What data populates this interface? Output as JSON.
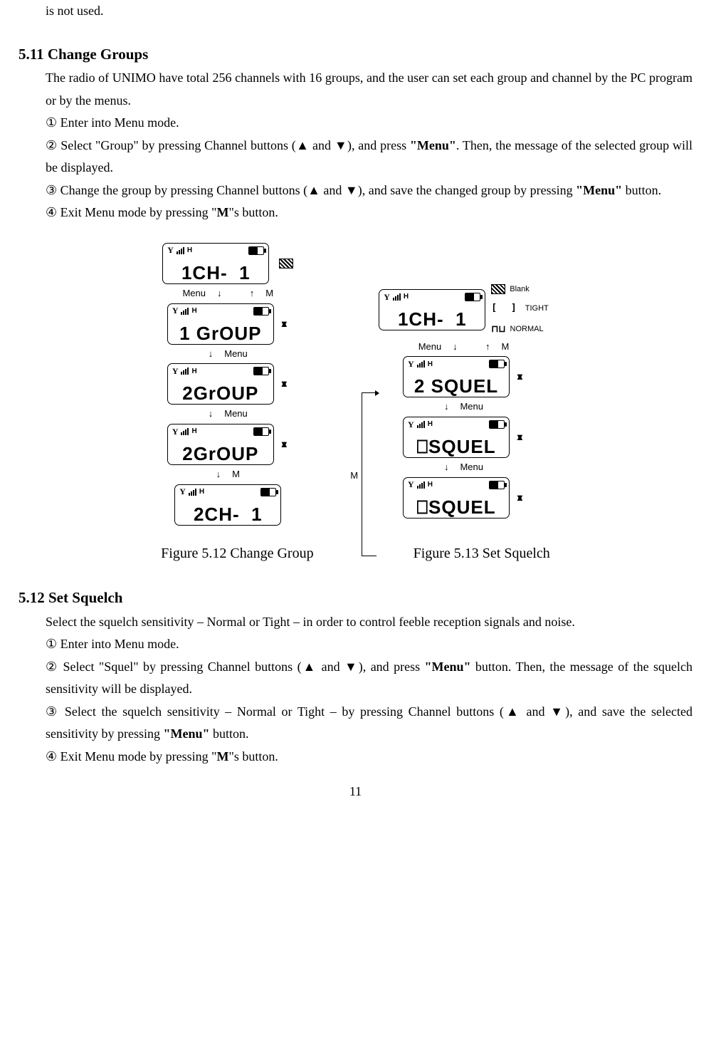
{
  "topFragment": "is not used.",
  "section511": {
    "heading": "5.11 Change Groups",
    "intro": "The radio of UNIMO have total 256 channels with 16 groups, and the user can set each group and channel by the PC program or by the menus.",
    "step1": "① Enter into Menu mode.",
    "step2a": "② Select \"Group\" by pressing Channel buttons (▲ and ▼), and press ",
    "step2b": "\"Menu\"",
    "step2c": ". Then, the message of the selected group will be displayed.",
    "step3a": "③ Change the group by pressing Channel buttons (▲ and ▼), and save the changed group by pressing ",
    "step3b": "\"Menu\"",
    "step3c": " button.",
    "step4a": "④ Exit Menu mode by pressing \"",
    "step4b": "M",
    "step4c": "\"s button."
  },
  "figureLeft": {
    "s1": "1CH-  1",
    "s2": "1 GrOUP",
    "s3": "2GrOUP",
    "s4": "2GrOUP",
    "s5": "2CH-  1",
    "labels": {
      "menu": "Menu",
      "m": "M"
    }
  },
  "figureRight": {
    "s1": "1CH-  1",
    "s2": "2 SQUEL",
    "s3": "⎕SQUEL",
    "s4": "⎕SQUEL",
    "labels": {
      "menu": "Menu",
      "m": "M",
      "blank": "Blank",
      "tight": "TIGHT",
      "normal": "NORMAL"
    }
  },
  "captionLeft": "Figure 5.12 Change Group",
  "captionRight": "Figure 5.13 Set Squelch",
  "section512": {
    "heading": "5.12 Set Squelch",
    "intro": "Select the squelch sensitivity – Normal or Tight – in order to control feeble reception signals and noise.",
    "step1": "① Enter into Menu mode.",
    "step2a": "② Select \"Squel\" by pressing Channel buttons (▲ and ▼), and press ",
    "step2b": "\"Menu\"",
    "step2c": " button.   Then, the message of the squelch sensitivity will be displayed.",
    "step3a": "③ Select the squelch sensitivity – Normal or Tight – by pressing Channel buttons (▲ and ▼), and save the selected sensitivity by pressing ",
    "step3b": "\"Menu\"",
    "step3c": " button.",
    "step4a": "④ Exit Menu mode by pressing \"",
    "step4b": "M",
    "step4c": "\"s button."
  },
  "pageNumber": "11"
}
